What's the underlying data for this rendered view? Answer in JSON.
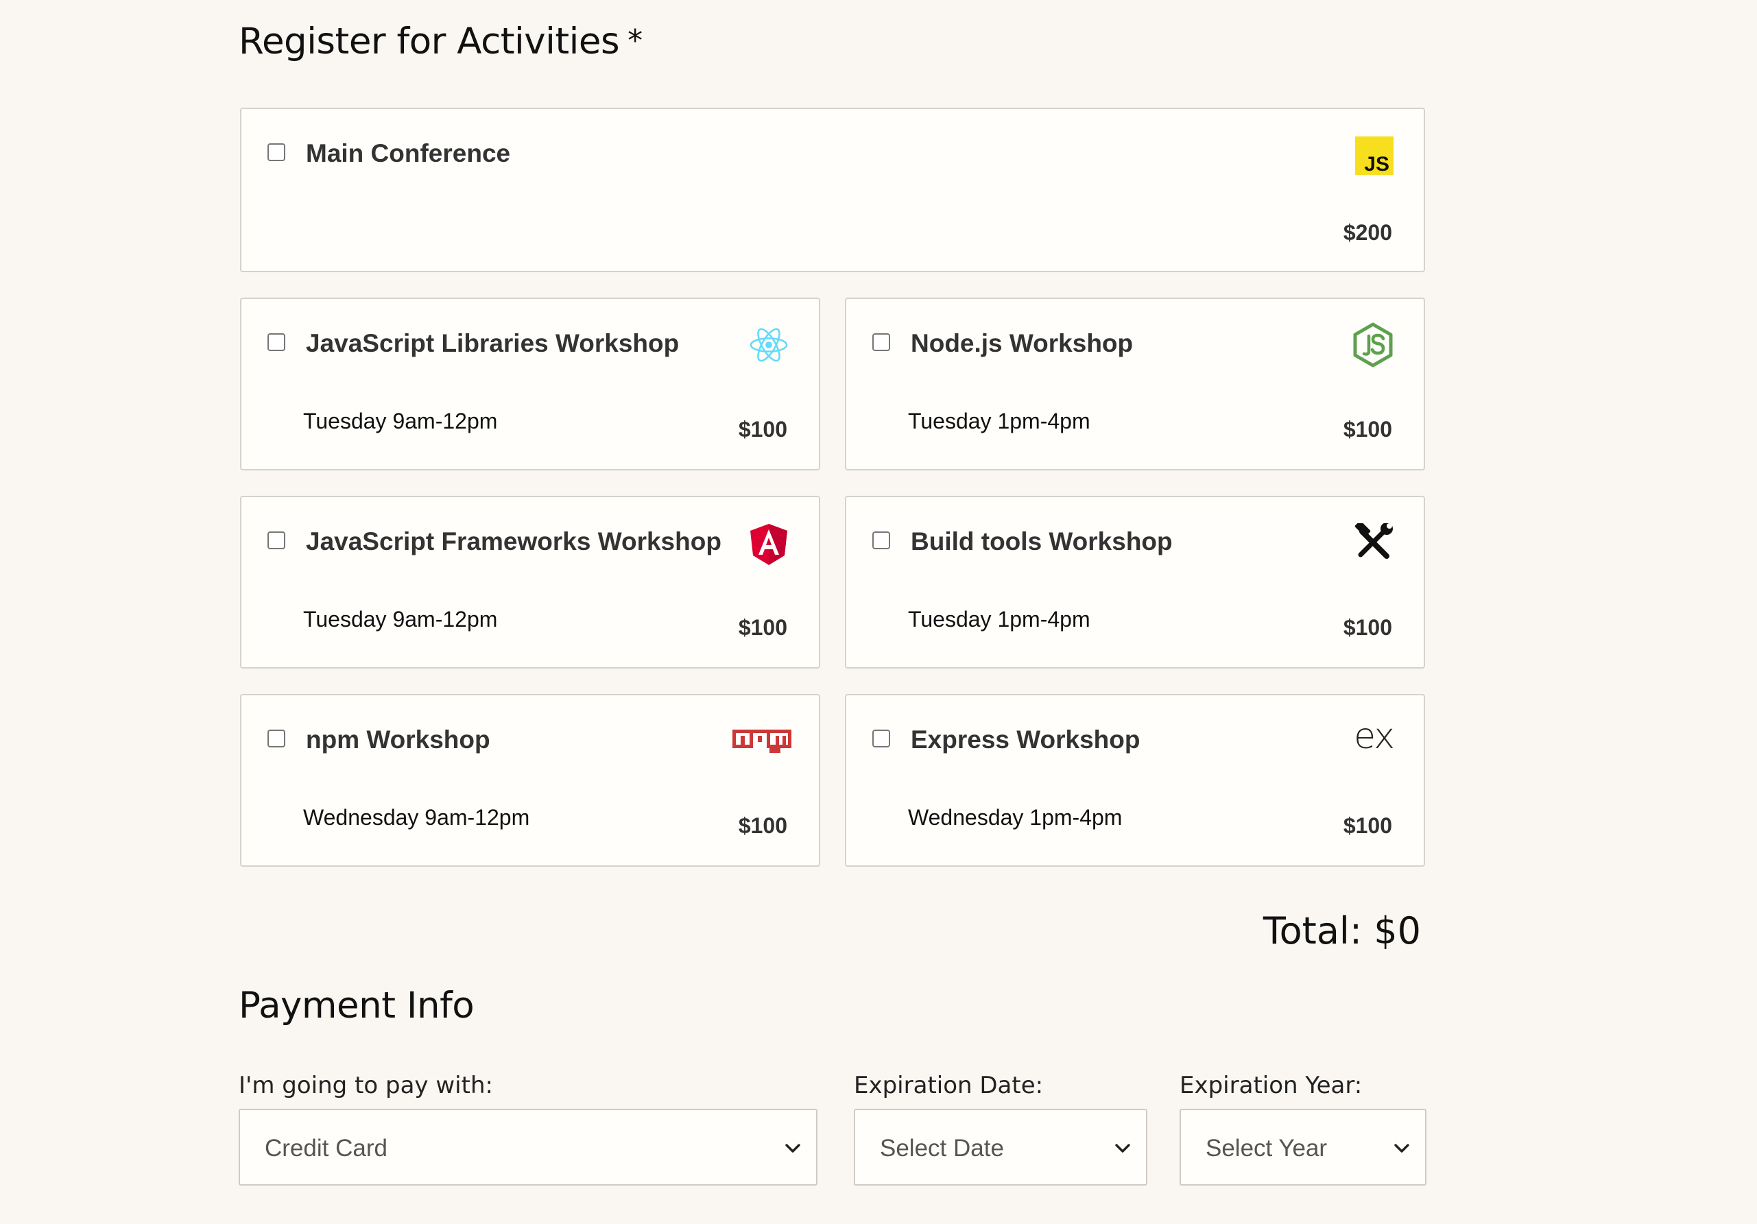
{
  "activities": {
    "heading": "Register for Activities",
    "required_mark": "*",
    "items": [
      {
        "title": "Main Conference",
        "time": "",
        "price": "$200",
        "icon": "javascript-icon"
      },
      {
        "title": "JavaScript Libraries Workshop",
        "time": "Tuesday 9am-12pm",
        "price": "$100",
        "icon": "react-icon"
      },
      {
        "title": "Node.js Workshop",
        "time": "Tuesday 1pm-4pm",
        "price": "$100",
        "icon": "nodejs-icon"
      },
      {
        "title": "JavaScript Frameworks Workshop",
        "time": "Tuesday 9am-12pm",
        "price": "$100",
        "icon": "angular-icon"
      },
      {
        "title": "Build tools Workshop",
        "time": "Tuesday 1pm-4pm",
        "price": "$100",
        "icon": "tools-icon"
      },
      {
        "title": "npm Workshop",
        "time": "Wednesday 9am-12pm",
        "price": "$100",
        "icon": "npm-icon"
      },
      {
        "title": "Express Workshop",
        "time": "Wednesday 1pm-4pm",
        "price": "$100",
        "icon": "express-icon"
      }
    ],
    "total": "Total: $0",
    "js_badge_text": "JS",
    "express_logo_text": "ex"
  },
  "payment": {
    "heading": "Payment Info",
    "method_label": "I'm going to pay with:",
    "method_value": "Credit Card",
    "exp_date_label": "Expiration Date:",
    "exp_date_value": "Select Date",
    "exp_year_label": "Expiration Year:",
    "exp_year_value": "Select Year"
  },
  "colors": {
    "background": "#faf7f2",
    "card": "#fffefa",
    "js_yellow": "#f7df1e",
    "react_blue": "#61dafb",
    "node_green": "#5fa04e",
    "angular_red": "#dd0031",
    "npm_red": "#cb3837"
  }
}
